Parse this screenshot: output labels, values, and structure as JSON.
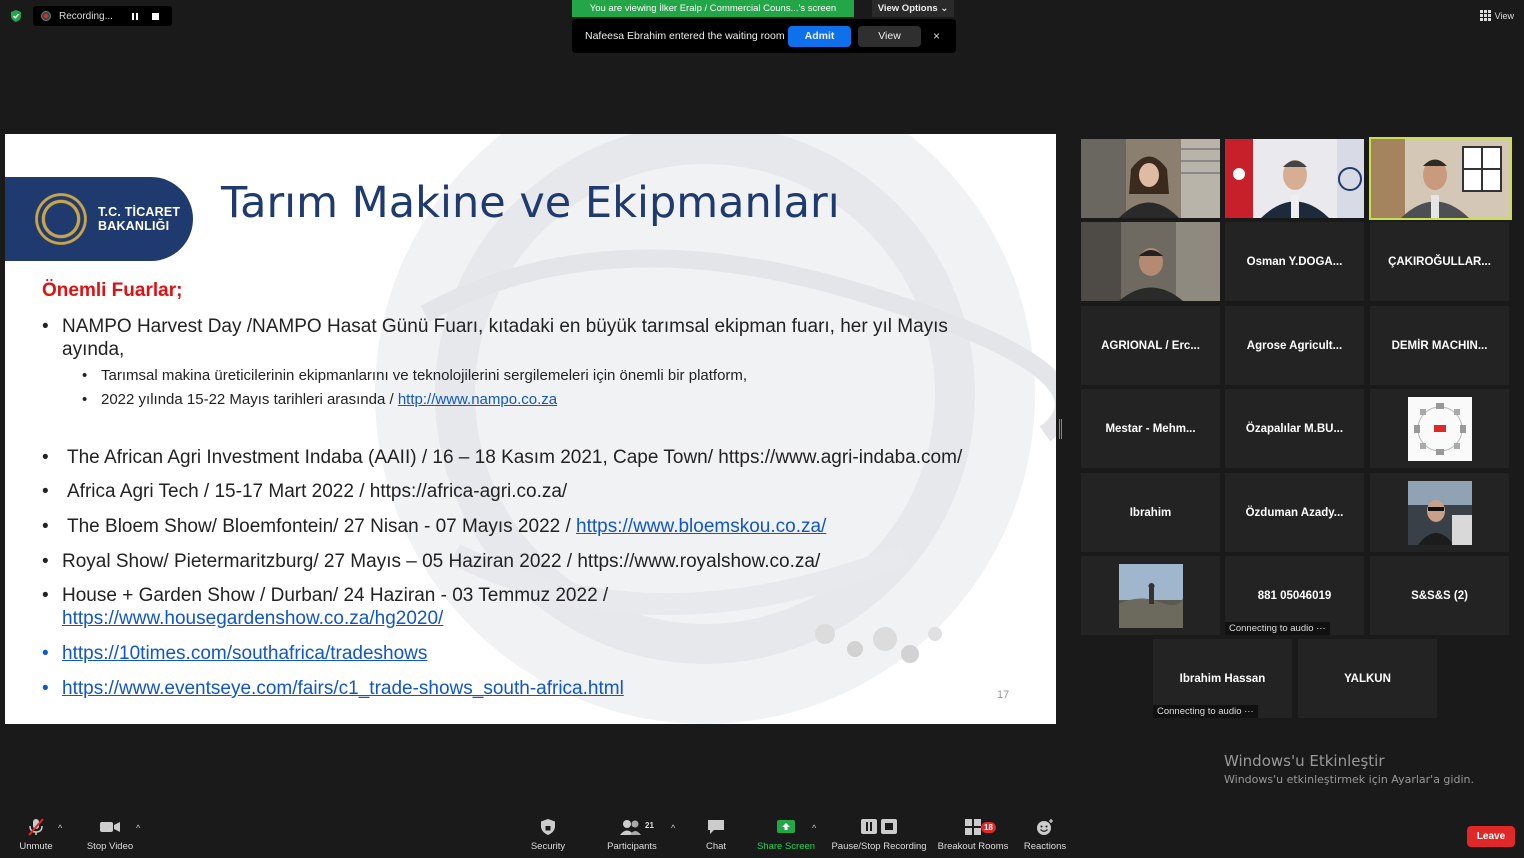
{
  "top": {
    "recording_label": "Recording...",
    "viewing_banner": "You are viewing İlker Eralp / Commercial Couns...'s screen",
    "view_options": "View Options",
    "waiting_message": "Nafeesa Ebrahim entered the waiting room",
    "admit_label": "Admit",
    "view_label": "View",
    "close_glyph": "×",
    "gallery_view_label": "View"
  },
  "slide": {
    "logo_line1": "T.C. TİCARET",
    "logo_line2": "BAKANLIĞI",
    "title": "Tarım Makine ve Ekipmanları",
    "section_heading": "Önemli Fuarlar;",
    "bullet_glyph": "•",
    "bullet1_line1": "NAMPO Harvest Day /NAMPO Hasat Günü Fuarı, kıtadaki en büyük tarımsal ekipman fuarı, her yıl Mayıs",
    "bullet1_line2": "ayında,",
    "sub1": "Tarımsal makina üreticilerinin ekipmanlarını ve teknolojilerini sergilemeleri için önemli bir platform,",
    "sub2_text": "2022 yılında 15-22 Mayıs tarihleri arasında / ",
    "sub2_link": "http://www.nampo.co.za",
    "bullet2": "The African Agri Investment Indaba (AAII) / 16 – 18 Kasım 2021, Cape Town/ https://www.agri-indaba.com/",
    "bullet3": "Africa Agri Tech / 15-17 Mart 2022 / https://africa-agri.co.za/",
    "bullet4_text": "The Bloem Show/ Bloemfontein/ 27 Nisan - 07 Mayıs 2022 / ",
    "bullet4_link": "https://www.bloemskou.co.za/",
    "bullet5": "Royal Show/ Pietermaritzburg/ 27 Mayıs – 05 Haziran 2022 / https://www.royalshow.co.za/",
    "bullet6_line1": "House + Garden Show / Durban/ 24 Haziran - 03 Temmuz 2022 /",
    "bullet6_link": "https://www.housegardenshow.co.za/hg2020/",
    "bullet7_link": "https://10times.com/southafrica/tradeshows",
    "bullet8_link": "https://www.eventseye.com/fairs/c1_trade-shows_south-africa.html",
    "page_number": "17"
  },
  "gallery": {
    "names": {
      "osman": "Osman  Y.DOGA...",
      "cakiroglu": "ÇAKIROĞULLAR...",
      "agrional": "AGRIONAL / Erc...",
      "agrose": "Agrose  Agricult...",
      "demir": "DEMİR  MACHIN...",
      "mestar": "Mestar  -  Mehm...",
      "ozapalilar": "Özapalılar  M.BU...",
      "ibrahim": "Ibrahim",
      "ozduman": "Özduman  Azady...",
      "phone": "881 05046019",
      "sss": "S&S&S (2)",
      "ibrahim_hassan": "Ibrahim Hassan",
      "yalkun": "YALKUN"
    },
    "connecting_label": "Connecting to audio ···"
  },
  "watermark": {
    "line1": "Windows'u Etkinleştir",
    "line2": "Windows'u etkinleştirmek için Ayarlar'a gidin."
  },
  "toolbar": {
    "unmute": "Unmute",
    "stop_video": "Stop Video",
    "security": "Security",
    "participants": "Participants",
    "participants_count": "21",
    "chat": "Chat",
    "share_screen": "Share Screen",
    "pause_stop_recording": "Pause/Stop Recording",
    "breakout_rooms": "Breakout Rooms",
    "breakout_badge": "18",
    "reactions": "Reactions",
    "leave": "Leave",
    "caret": "^"
  },
  "colors": {
    "green_banner": "#23a647",
    "admit_blue": "#0e71eb",
    "leave_red": "#e02828",
    "slide_title_navy": "#1f3a6e",
    "heading_red": "#e01010",
    "link_blue": "#1155cc",
    "active_speaker_border": "#c9e04a"
  },
  "icons": [
    "shield-icon",
    "record-icon",
    "pause-icon",
    "stop-icon",
    "grid-icon",
    "mic-muted-icon",
    "video-icon",
    "security-icon",
    "participants-icon",
    "chat-icon",
    "share-screen-icon",
    "pause-stop-recording-icon",
    "breakout-rooms-icon",
    "reactions-icon"
  ]
}
